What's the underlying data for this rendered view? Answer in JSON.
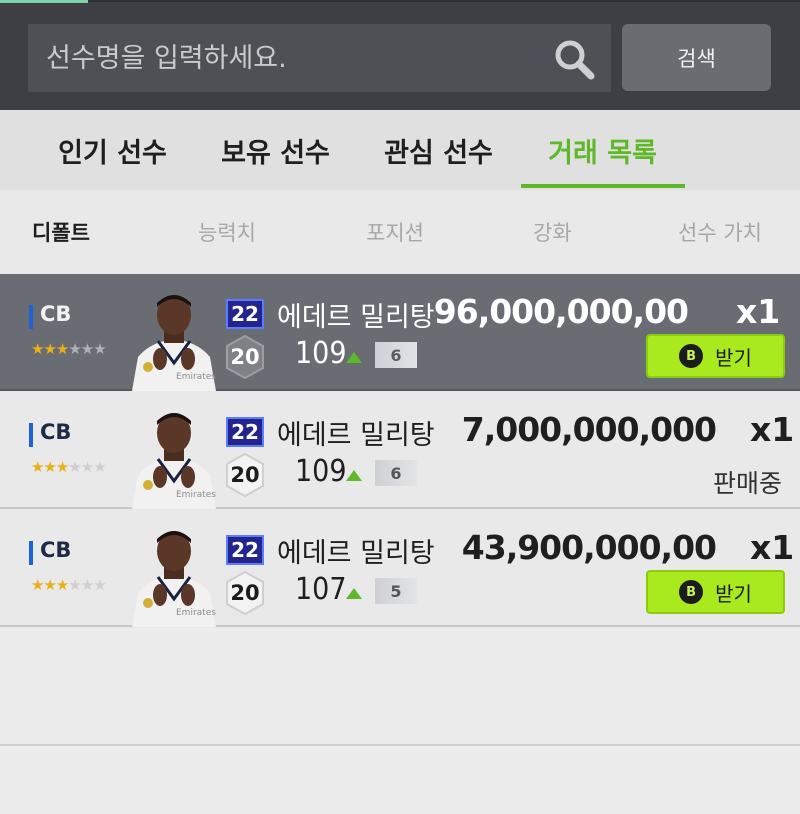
{
  "search": {
    "placeholder": "선수명을 입력하세요.",
    "button_label": "검색"
  },
  "tabs": [
    {
      "label": "인기 선수",
      "active": false
    },
    {
      "label": "보유 선수",
      "active": false
    },
    {
      "label": "관심 선수",
      "active": false
    },
    {
      "label": "거래 목록",
      "active": true
    }
  ],
  "sort": [
    "디폴트",
    "능력치",
    "포지션",
    "강화",
    "선수 가치"
  ],
  "colors": {
    "accent": "#5fb829",
    "claim_button": "#a9ea1e",
    "header_bg": "#3d3f45",
    "selected_row": "#6a6c73"
  },
  "rows": [
    {
      "position": "CB",
      "stars": 3,
      "season": "22",
      "name": "에데르 밀리탕",
      "ovr": "20",
      "rating": "109",
      "upgrade": "6",
      "price": "96,000,000,00",
      "qty": "x1",
      "action": "받기",
      "coin_icon": "B",
      "selected": true
    },
    {
      "position": "CB",
      "stars": 3,
      "season": "22",
      "name": "에데르 밀리탕",
      "ovr": "20",
      "rating": "109",
      "upgrade": "6",
      "price": "7,000,000,000",
      "qty": "x1",
      "status": "판매중",
      "selected": false
    },
    {
      "position": "CB",
      "stars": 3,
      "season": "22",
      "name": "에데르 밀리탕",
      "ovr": "20",
      "rating": "107",
      "upgrade": "5",
      "price": "43,900,000,00",
      "qty": "x1",
      "action": "받기",
      "coin_icon": "B",
      "selected": false
    }
  ]
}
